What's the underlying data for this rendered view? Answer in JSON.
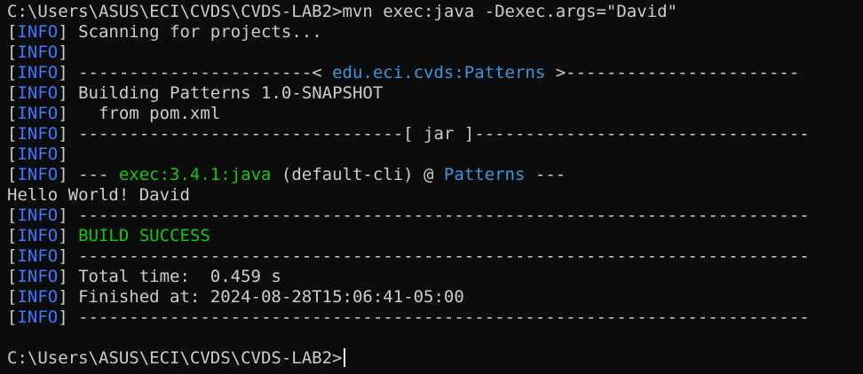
{
  "terminal": {
    "lines": [
      {
        "segments": [
          {
            "text": "C:\\Users\\ASUS\\ECI\\CVDS\\CVDS-LAB2>mvn exec:java -Dexec.args=\"David\"",
            "color": "w"
          }
        ]
      },
      {
        "segments": [
          {
            "text": "[",
            "color": "w"
          },
          {
            "text": "INFO",
            "color": "b"
          },
          {
            "text": "] Scanning for projects...",
            "color": "w"
          }
        ]
      },
      {
        "segments": [
          {
            "text": "[",
            "color": "w"
          },
          {
            "text": "INFO",
            "color": "b"
          },
          {
            "text": "]",
            "color": "w"
          }
        ]
      },
      {
        "segments": [
          {
            "text": "[",
            "color": "w"
          },
          {
            "text": "INFO",
            "color": "b"
          },
          {
            "text": "] -----------------------< ",
            "color": "w"
          },
          {
            "text": "edu.eci.cvds:Patterns",
            "color": "c"
          },
          {
            "text": " >-----------------------",
            "color": "w"
          }
        ]
      },
      {
        "segments": [
          {
            "text": "[",
            "color": "w"
          },
          {
            "text": "INFO",
            "color": "b"
          },
          {
            "text": "] Building Patterns 1.0-SNAPSHOT",
            "color": "w"
          }
        ]
      },
      {
        "segments": [
          {
            "text": "[",
            "color": "w"
          },
          {
            "text": "INFO",
            "color": "b"
          },
          {
            "text": "]   from pom.xml",
            "color": "w"
          }
        ]
      },
      {
        "segments": [
          {
            "text": "[",
            "color": "w"
          },
          {
            "text": "INFO",
            "color": "b"
          },
          {
            "text": "] --------------------------------[ jar ]---------------------------------",
            "color": "w"
          }
        ]
      },
      {
        "segments": [
          {
            "text": "[",
            "color": "w"
          },
          {
            "text": "INFO",
            "color": "b"
          },
          {
            "text": "]",
            "color": "w"
          }
        ]
      },
      {
        "segments": [
          {
            "text": "[",
            "color": "w"
          },
          {
            "text": "INFO",
            "color": "b"
          },
          {
            "text": "] --- ",
            "color": "w"
          },
          {
            "text": "exec:3.4.1:java",
            "color": "g"
          },
          {
            "text": " (default-cli) @ ",
            "color": "w"
          },
          {
            "text": "Patterns",
            "color": "c"
          },
          {
            "text": " ---",
            "color": "w"
          }
        ]
      },
      {
        "segments": [
          {
            "text": "Hello World! David",
            "color": "w"
          }
        ]
      },
      {
        "segments": [
          {
            "text": "[",
            "color": "w"
          },
          {
            "text": "INFO",
            "color": "b"
          },
          {
            "text": "] ------------------------------------------------------------------------",
            "color": "w"
          }
        ]
      },
      {
        "segments": [
          {
            "text": "[",
            "color": "w"
          },
          {
            "text": "INFO",
            "color": "b"
          },
          {
            "text": "] ",
            "color": "w"
          },
          {
            "text": "BUILD SUCCESS",
            "color": "g"
          }
        ]
      },
      {
        "segments": [
          {
            "text": "[",
            "color": "w"
          },
          {
            "text": "INFO",
            "color": "b"
          },
          {
            "text": "] ------------------------------------------------------------------------",
            "color": "w"
          }
        ]
      },
      {
        "segments": [
          {
            "text": "[",
            "color": "w"
          },
          {
            "text": "INFO",
            "color": "b"
          },
          {
            "text": "] Total time:  0.459 s",
            "color": "w"
          }
        ]
      },
      {
        "segments": [
          {
            "text": "[",
            "color": "w"
          },
          {
            "text": "INFO",
            "color": "b"
          },
          {
            "text": "] Finished at: 2024-08-28T15:06:41-05:00",
            "color": "w"
          }
        ]
      },
      {
        "segments": [
          {
            "text": "[",
            "color": "w"
          },
          {
            "text": "INFO",
            "color": "b"
          },
          {
            "text": "] ------------------------------------------------------------------------",
            "color": "w"
          }
        ]
      },
      {
        "segments": []
      }
    ],
    "prompt": "C:\\Users\\ASUS\\ECI\\CVDS\\CVDS-LAB2>"
  },
  "colors": {
    "background": "#0c0c0c",
    "text": "#cccccc",
    "info": "#3b78ff",
    "success": "#16c60c",
    "project": "#3a96dd"
  }
}
